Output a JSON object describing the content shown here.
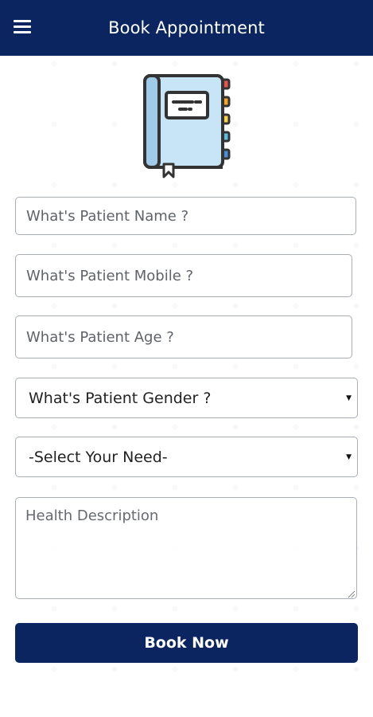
{
  "header": {
    "title": "Book Appointment",
    "menu_icon": "hamburger-menu-icon",
    "background": "#0b2560"
  },
  "logo": {
    "icon": "notebook-icon",
    "cover_color": "#c8e4f7",
    "tab_colors": [
      "#e8534f",
      "#f5a623",
      "#f7d44c",
      "#5bc0de",
      "#4a90d9"
    ]
  },
  "form": {
    "name_placeholder": "What's Patient Name ?",
    "mobile_placeholder": "What's Patient Mobile ?",
    "age_placeholder": "What's Patient Age ?",
    "gender_selected": "What's Patient Gender ?",
    "need_selected": "-Select Your Need-",
    "description_placeholder": "Health Description",
    "submit_label": "Book Now"
  },
  "colors": {
    "primary": "#0b2560",
    "border": "#a9aeb4"
  }
}
